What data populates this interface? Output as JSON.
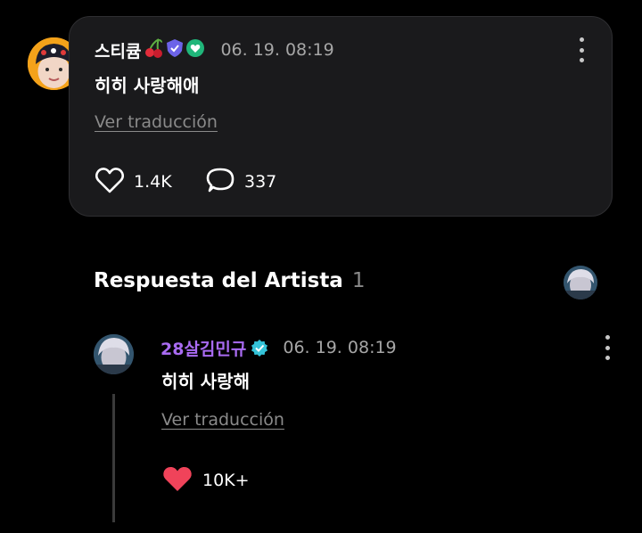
{
  "post": {
    "username": "스티큠",
    "timestamp": "06. 19. 08:19",
    "text": "히히 사랑해애",
    "translate_label": "Ver traducción",
    "likes": "1.4K",
    "comments": "337",
    "badges": [
      "cherry-icon",
      "shield-badge-icon",
      "heart-badge-icon"
    ]
  },
  "artist_section": {
    "title": "Respuesta del Artista",
    "count": "1"
  },
  "reply": {
    "username": "28살김민규",
    "verified_icon": "verified-check-icon",
    "timestamp": "06. 19. 08:19",
    "text": "히히 사랑해",
    "translate_label": "Ver traducción",
    "likes": "10K+",
    "liked": true
  },
  "colors": {
    "background": "#000000",
    "card": "#1a1a1c",
    "artist_name": "#a96bf2",
    "like_active": "#f0435a",
    "verified": "#34c3d8",
    "muted": "#8a8a8a"
  }
}
